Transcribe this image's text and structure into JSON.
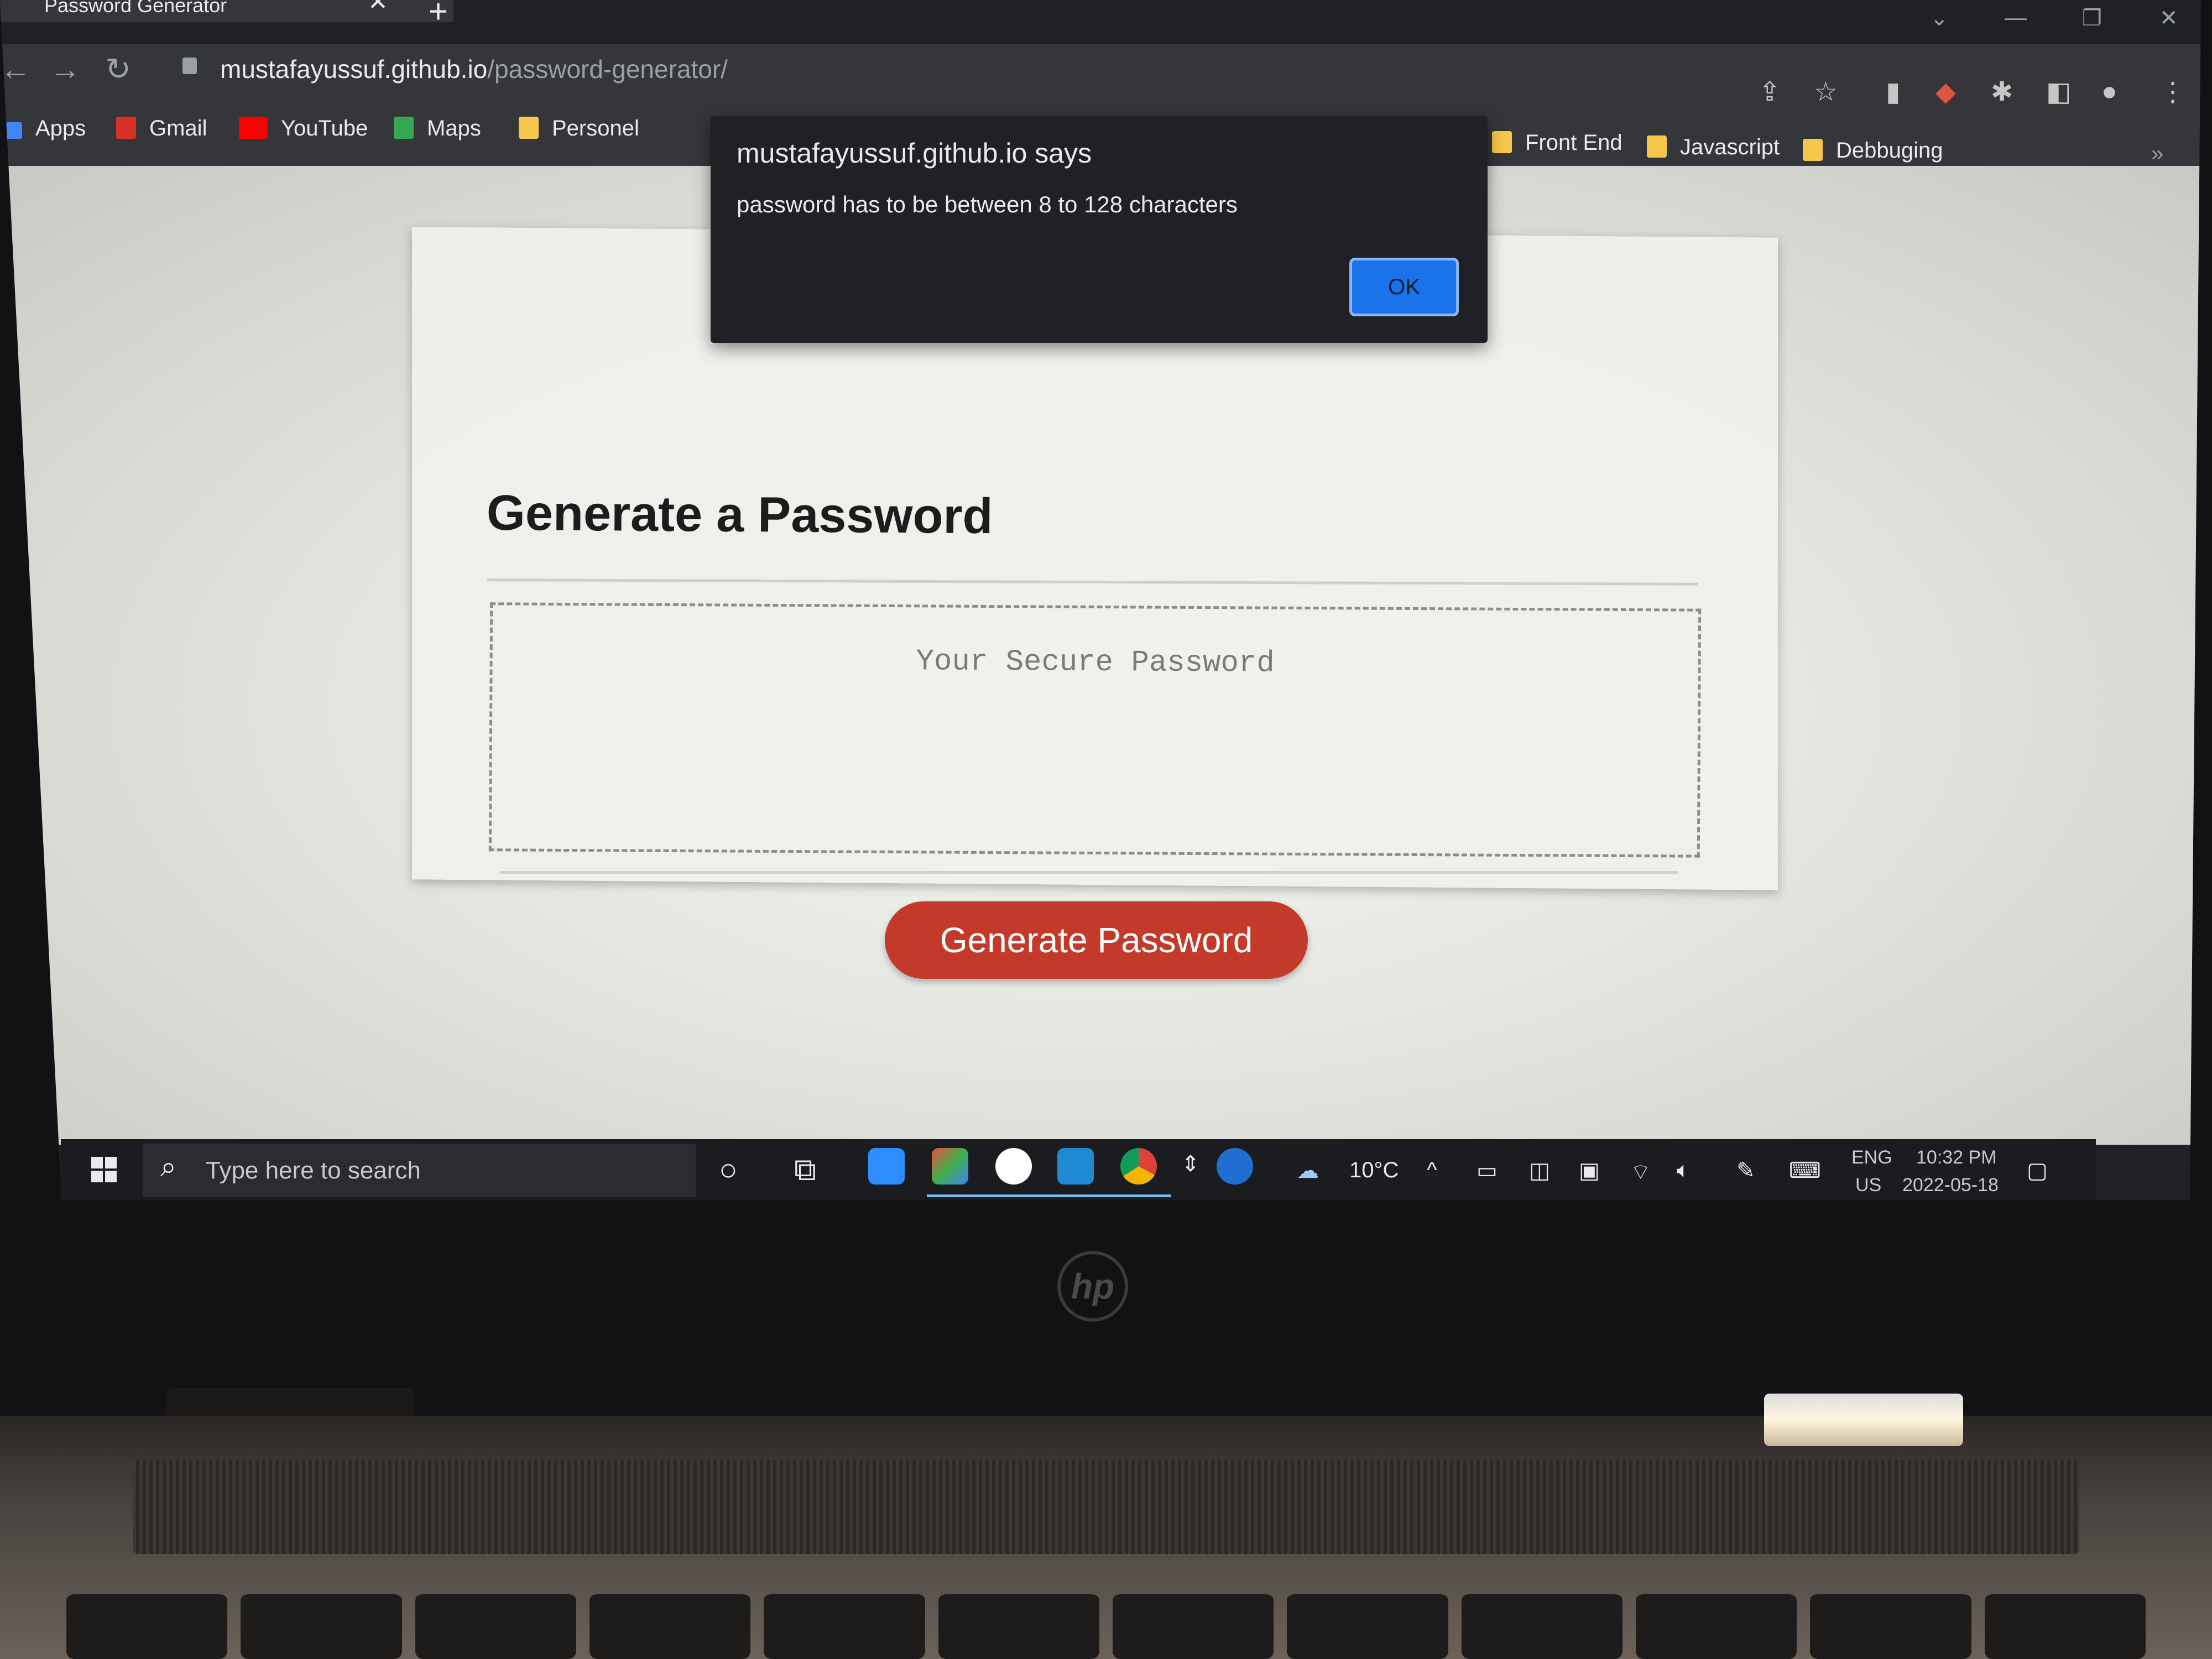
{
  "browser": {
    "tab_title": "Password Generator",
    "url_host": "mustafayussuf.github.io",
    "url_path": "/password-generator/",
    "bookmarks": [
      "Apps",
      "Gmail",
      "YouTube",
      "Maps",
      "Personel",
      "Front End",
      "Javascript",
      "Debbuging"
    ]
  },
  "dialog": {
    "title": "mustafayussuf.github.io says",
    "message": "password has to be between 8 to 128 characters",
    "ok_label": "OK"
  },
  "page": {
    "heading": "Generate a Password",
    "password_placeholder": "Your Secure Password",
    "generate_label": "Generate Password",
    "button_color": "#c43a2a"
  },
  "taskbar": {
    "search_placeholder": "Type here to search",
    "weather": "10°C",
    "language": "ENG",
    "region": "US",
    "time": "10:32 PM",
    "date": "2022-05-18"
  },
  "device": {
    "logo": "hp"
  }
}
